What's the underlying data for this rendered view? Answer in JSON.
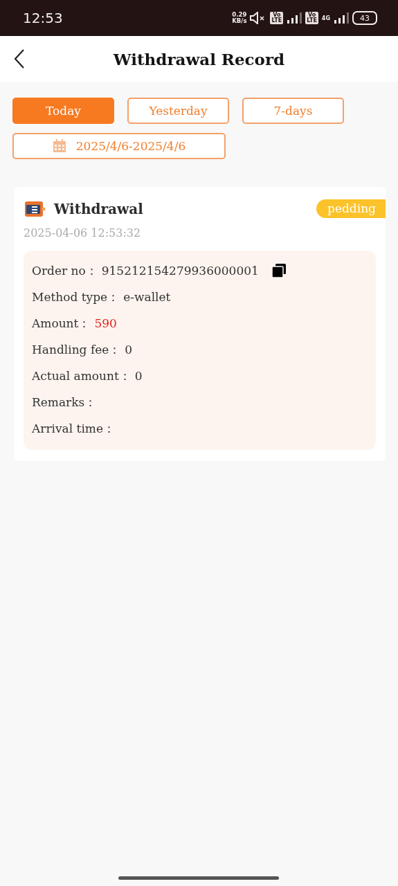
{
  "status_bar": {
    "time": "12:53",
    "speed_value": "0.29",
    "speed_unit": "KB/s",
    "volte_1": [
      "Vo",
      "LTE"
    ],
    "volte_2": [
      "Vo",
      "LTE"
    ],
    "network": "4G",
    "battery": "43"
  },
  "header": {
    "title": "Withdrawal Record"
  },
  "filters": [
    {
      "label": "Today",
      "selected": true
    },
    {
      "label": "Yesterday",
      "selected": false
    },
    {
      "label": "7-days",
      "selected": false
    }
  ],
  "date_range": "2025/4/6-2025/4/6",
  "records": [
    {
      "title": "Withdrawal",
      "status": "pedding",
      "time": "2025-04-06 12:53:32",
      "fields": [
        {
          "label": "Order no：",
          "value": "915212154279936000001",
          "kind": "copy"
        },
        {
          "label": "Method type：",
          "value": "e-wallet",
          "kind": "plain"
        },
        {
          "label": "Amount：",
          "value": "590",
          "kind": "highlight"
        },
        {
          "label": "Handling fee：",
          "value": "0",
          "kind": "plain"
        },
        {
          "label": "Actual amount：",
          "value": "0",
          "kind": "plain"
        },
        {
          "label": "Remarks：",
          "kind": "plain"
        },
        {
          "label": "Arrival time：",
          "kind": "plain"
        }
      ]
    }
  ]
}
